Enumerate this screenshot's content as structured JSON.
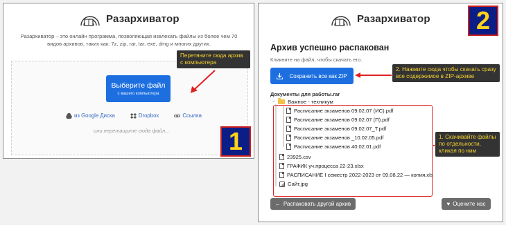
{
  "brand": {
    "name": "Разархиватор"
  },
  "left": {
    "description": "Разархиватор – это онлайн программа, позволяющая извлекать файлы из более чем 70 видов архивов, таких как: 7z, zip, rar, tar, exe, dmg и многих других.",
    "choose_button": {
      "label": "Выберите файл",
      "sublabel": "с вашего компьютера"
    },
    "callout": "Перетяните сюда архив с компьютера",
    "links": [
      {
        "icon": "google-drive-icon",
        "label": "из Google Диска"
      },
      {
        "icon": "dropbox-icon",
        "label": "Dropbox"
      },
      {
        "icon": "link-icon",
        "label": "Ссылка"
      }
    ],
    "drop_hint": "или перетащите сюда файл...",
    "badge": "1"
  },
  "right": {
    "heading": "Архив успешно распакован",
    "subtext": "Кликните на файл, чтобы скачать его.",
    "save_zip": "Сохранить все как ZIP",
    "callout_zip": "2. Нажмите сюда чтобы скачать сразу все содержимое в ZIP-архиве",
    "archive_name": "Документы для работы.rar",
    "folder": "Важное - техникум",
    "folder_files": [
      "Расписание экзаменов 09.02.07 (ИС).pdf",
      "Расписание экзаменов 09.02.07 (П).pdf",
      "Расписание экзаменов 09.02.07_Т.pdf",
      "Расписание экзаменов _10.02.05.pdf",
      "Расписание экзаменов 40.02.01.pdf"
    ],
    "root_files": [
      {
        "name": "23925.csv",
        "icon": "file-icon"
      },
      {
        "name": "ГРАФИК уч.процесса 22-23.xlsx",
        "icon": "file-icon"
      },
      {
        "name": "РАСПИСАНИЕ I семестр 2022-2023 от 09.08.22 — копия.xls",
        "icon": "file-icon"
      },
      {
        "name": "Сайт.jpg",
        "icon": "image-icon"
      }
    ],
    "callout_files": "1. Скачивайте файлы по отдельности, кликая по ним",
    "unpack_other": "Распаковать другой архив",
    "rate_us": "Оцените нас",
    "badge": "2"
  },
  "colors": {
    "primary": "#1d6fe0",
    "badge_bg": "#0b1e86",
    "badge_text": "#ffd21a",
    "highlight_red": "#e02020",
    "callout_bg": "#333333",
    "callout_text": "#f5d233"
  }
}
